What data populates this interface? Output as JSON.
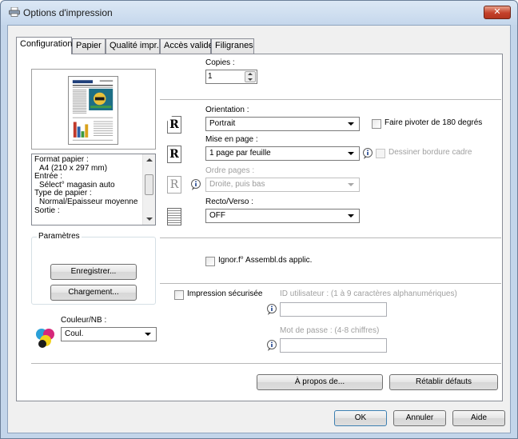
{
  "window": {
    "title": "Options d'impression",
    "close_label": "✕"
  },
  "tabs": [
    "Configuration",
    "Papier",
    "Qualité impr.",
    "Accès valide",
    "Filigranes"
  ],
  "preview": {
    "info_lines": [
      "Format papier :",
      "A4 (210 x 297 mm)",
      "Entrée :",
      "Sélect° magasin auto",
      "Type de papier :",
      "Normal/Epaisseur moyenne",
      "Sortie :"
    ]
  },
  "settings_group": {
    "title": "Paramètres",
    "save_label": "Enregistrer...",
    "load_label": "Chargement..."
  },
  "color": {
    "label": "Couleur/NB :",
    "value": "Coul."
  },
  "copies": {
    "label": "Copies :",
    "value": "1"
  },
  "orientation": {
    "label": "Orientation :",
    "value": "Portrait",
    "rotate_label": "Faire pivoter de 180 degrés"
  },
  "layout": {
    "label": "Mise en page :",
    "value": "1 page par feuille",
    "border_label": "Dessiner bordure cadre"
  },
  "page_order": {
    "label": "Ordre pages :",
    "value": "Droite, puis bas"
  },
  "duplex": {
    "label": "Recto/Verso :",
    "value": "OFF"
  },
  "collate": {
    "label": "Ignor.f° Assembl.ds applic."
  },
  "secure": {
    "label": "Impression sécurisée",
    "user_id_label": "ID utilisateur : (1 à 9 caractères alphanumériques)",
    "password_label": "Mot de passe : (4-8 chiffres)"
  },
  "panel_buttons": {
    "about": "À propos de...",
    "defaults": "Rétablir défauts"
  },
  "dialog_buttons": {
    "ok": "OK",
    "cancel": "Annuler",
    "help": "Aide"
  },
  "icons": {
    "r_letter": "R"
  },
  "colors": {
    "accent": "#3c7fb1",
    "close_red": "#c4412a"
  }
}
